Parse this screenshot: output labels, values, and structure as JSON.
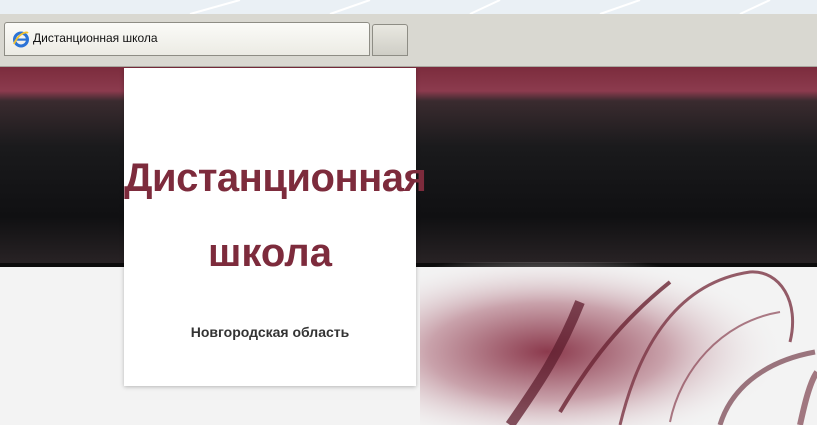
{
  "browser": {
    "tab_title": "Дистанционная школа",
    "tab_icon": "internet-explorer-icon"
  },
  "site": {
    "logo_line1": "Дистанционная",
    "logo_line2": "школа",
    "region": "Новгородская область"
  },
  "colors": {
    "brand": "#7d2b3c",
    "header_dark": "#101012",
    "page_bg": "#f3f3f3"
  }
}
